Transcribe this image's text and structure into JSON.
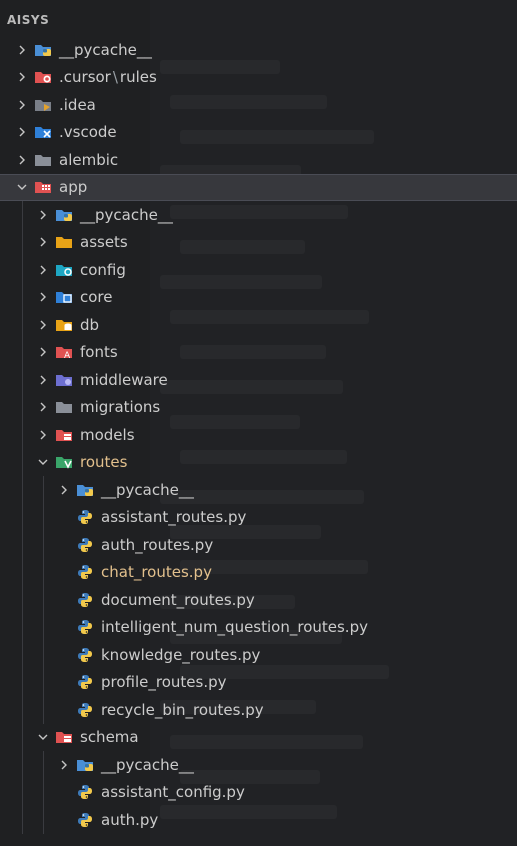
{
  "explorer": {
    "title": "AISYS",
    "rows": [
      {
        "name": "folder-pycache-root",
        "label": "__pycache__",
        "depth": 0,
        "kind": "folder",
        "icon": "python-folder-icon",
        "expanded": false
      },
      {
        "name": "folder-cursor-rules",
        "label": ".cursor",
        "label_sep": "\\",
        "label_suffix": "rules",
        "depth": 0,
        "kind": "folder",
        "icon": "cursor-folder-icon",
        "expanded": false
      },
      {
        "name": "folder-idea",
        "label": ".idea",
        "depth": 0,
        "kind": "folder",
        "icon": "idea-folder-icon",
        "expanded": false
      },
      {
        "name": "folder-vscode",
        "label": ".vscode",
        "depth": 0,
        "kind": "folder",
        "icon": "vscode-folder-icon",
        "expanded": false
      },
      {
        "name": "folder-alembic",
        "label": "alembic",
        "depth": 0,
        "kind": "folder",
        "icon": "folder-icon",
        "expanded": false
      },
      {
        "name": "folder-app",
        "label": "app",
        "depth": 0,
        "kind": "folder",
        "icon": "app-folder-icon",
        "expanded": true,
        "selected": true
      },
      {
        "name": "folder-app-pycache",
        "label": "__pycache__",
        "depth": 1,
        "kind": "folder",
        "icon": "python-folder-icon",
        "expanded": false
      },
      {
        "name": "folder-assets",
        "label": "assets",
        "depth": 1,
        "kind": "folder",
        "icon": "assets-folder-icon",
        "expanded": false
      },
      {
        "name": "folder-config",
        "label": "config",
        "depth": 1,
        "kind": "folder",
        "icon": "config-folder-icon",
        "expanded": false
      },
      {
        "name": "folder-core",
        "label": "core",
        "depth": 1,
        "kind": "folder",
        "icon": "core-folder-icon",
        "expanded": false
      },
      {
        "name": "folder-db",
        "label": "db",
        "depth": 1,
        "kind": "folder",
        "icon": "db-folder-icon",
        "expanded": false
      },
      {
        "name": "folder-fonts",
        "label": "fonts",
        "depth": 1,
        "kind": "folder",
        "icon": "fonts-folder-icon",
        "expanded": false
      },
      {
        "name": "folder-middleware",
        "label": "middleware",
        "depth": 1,
        "kind": "folder",
        "icon": "middleware-folder-icon",
        "expanded": false
      },
      {
        "name": "folder-migrations",
        "label": "migrations",
        "depth": 1,
        "kind": "folder",
        "icon": "folder-icon",
        "expanded": false
      },
      {
        "name": "folder-models",
        "label": "models",
        "depth": 1,
        "kind": "folder",
        "icon": "models-folder-icon",
        "expanded": false
      },
      {
        "name": "folder-routes",
        "label": "routes",
        "depth": 1,
        "kind": "folder",
        "icon": "routes-folder-icon",
        "expanded": true,
        "highlight": true
      },
      {
        "name": "folder-routes-pycache",
        "label": "__pycache__",
        "depth": 2,
        "kind": "folder",
        "icon": "python-folder-icon",
        "expanded": false
      },
      {
        "name": "file-assistant-routes",
        "label": "assistant_routes.py",
        "depth": 2,
        "kind": "file",
        "icon": "python-file-icon"
      },
      {
        "name": "file-auth-routes",
        "label": "auth_routes.py",
        "depth": 2,
        "kind": "file",
        "icon": "python-file-icon"
      },
      {
        "name": "file-chat-routes",
        "label": "chat_routes.py",
        "depth": 2,
        "kind": "file",
        "icon": "python-file-icon",
        "highlight": true
      },
      {
        "name": "file-document-routes",
        "label": "document_routes.py",
        "depth": 2,
        "kind": "file",
        "icon": "python-file-icon"
      },
      {
        "name": "file-intelligent-num-question-routes",
        "label": "intelligent_num_question_routes.py",
        "depth": 2,
        "kind": "file",
        "icon": "python-file-icon"
      },
      {
        "name": "file-knowledge-routes",
        "label": "knowledge_routes.py",
        "depth": 2,
        "kind": "file",
        "icon": "python-file-icon"
      },
      {
        "name": "file-profile-routes",
        "label": "profile_routes.py",
        "depth": 2,
        "kind": "file",
        "icon": "python-file-icon"
      },
      {
        "name": "file-recycle-bin-routes",
        "label": "recycle_bin_routes.py",
        "depth": 2,
        "kind": "file",
        "icon": "python-file-icon"
      },
      {
        "name": "folder-schema",
        "label": "schema",
        "depth": 1,
        "kind": "folder",
        "icon": "schema-folder-icon",
        "expanded": true
      },
      {
        "name": "folder-schema-pycache",
        "label": "__pycache__",
        "depth": 2,
        "kind": "folder",
        "icon": "python-folder-icon",
        "expanded": false
      },
      {
        "name": "file-assistant-config",
        "label": "assistant_config.py",
        "depth": 2,
        "kind": "file",
        "icon": "python-file-icon"
      },
      {
        "name": "file-auth",
        "label": "auth.py",
        "depth": 2,
        "kind": "file",
        "icon": "python-file-icon"
      }
    ]
  },
  "colors": {
    "background": "#1f2022",
    "text": "#cccccc",
    "modified": "#e2c08d",
    "selected_row": "#37383d"
  }
}
